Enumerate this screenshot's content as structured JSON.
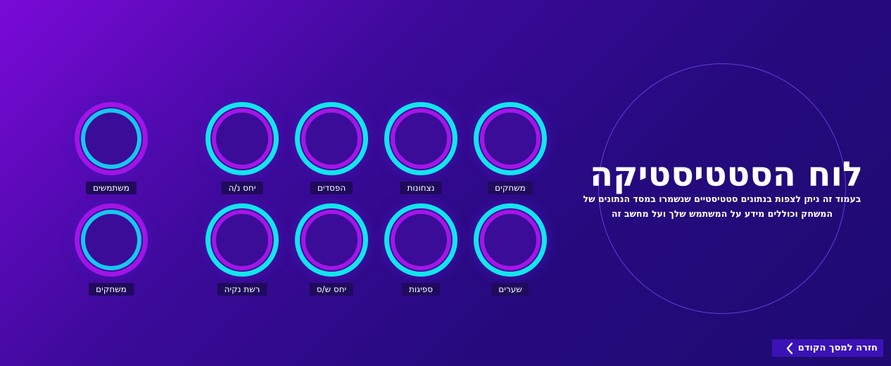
{
  "hero": {
    "title": "לוח הסטטיסטיקה",
    "description": "בעמוד זה ניתן לצפות בנתונים סטטיסטיים שנשמרו במסד הנתונים של המשחק וכוללים מידע על המשתמש שלך ועל מחשב זה"
  },
  "stats": {
    "row1": {
      "games": "משחקים",
      "wins": "נצחונות",
      "losses": "הפסדים",
      "win_loss_ratio": "יחס נ/ה",
      "users": "משתמשים"
    },
    "row2": {
      "goals": "שערים",
      "conceded": "ספיגות",
      "goals_ratio": "יחס ש/ס",
      "clean_sheet": "רשת נקיה",
      "games_machine": "משחקים"
    }
  },
  "back_button": {
    "label": "חזרה למסך הקודם",
    "icon": "chevron-left-icon"
  },
  "colors": {
    "cyan_ring": "#14e4ee",
    "purple_ring": "#a114e6",
    "button": "#3b12b5",
    "label_bg": "#1f0a5c"
  }
}
